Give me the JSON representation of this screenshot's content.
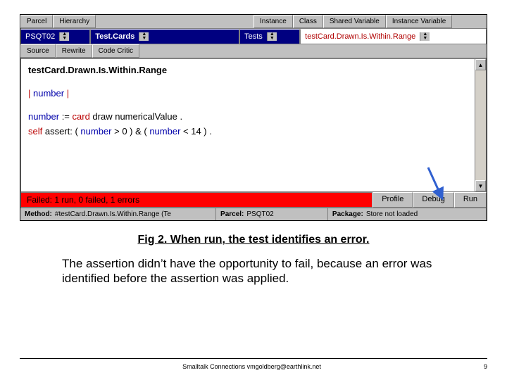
{
  "tabs_top_left": [
    "Parcel",
    "Hierarchy"
  ],
  "tabs_top_right": [
    "Instance",
    "Class",
    "Shared Variable",
    "Instance Variable"
  ],
  "pane1": "PSQT02",
  "pane2": "Test.Cards",
  "pane3": "Tests",
  "pane4": "testCard.Drawn.Is.Within.Range",
  "tabs_code": [
    "Source",
    "Rewrite",
    "Code Critic"
  ],
  "method_title": "testCard.Drawn.Is.Within.Range",
  "code_line1_a": "|",
  "code_line1_b": "number",
  "code_line1_c": "|",
  "code_line2_a": "number",
  "code_line2_b": " := ",
  "code_line2_c": "card",
  "code_line2_d": " draw numericalValue .",
  "code_line3_a": "self",
  "code_line3_b": " assert:   ( ",
  "code_line3_c": "number",
  "code_line3_d": " > 0 )    &    ( ",
  "code_line3_e": "number",
  "code_line3_f": "  < 14 ) .",
  "status_text": "Failed: 1 run, 0 failed, 1 errors",
  "btn_profile": "Profile",
  "btn_debug": "Debug",
  "btn_run": "Run",
  "footer_method_lbl": "Method:",
  "footer_method_val": "#testCard.Drawn.Is.Within.Range (Te",
  "footer_parcel_lbl": "Parcel:",
  "footer_parcel_val": "PSQT02",
  "footer_pkg_lbl": "Package:",
  "footer_pkg_val": "Store not loaded",
  "caption": "Fig 2.  When run, the test identifies an error.",
  "paragraph": "The assertion didn’t have the opportunity to fail, because an error was identified before the assertion was applied.",
  "credit": "Smalltalk Connections  vmgoldberg@earthlink.net",
  "page_num": "9"
}
